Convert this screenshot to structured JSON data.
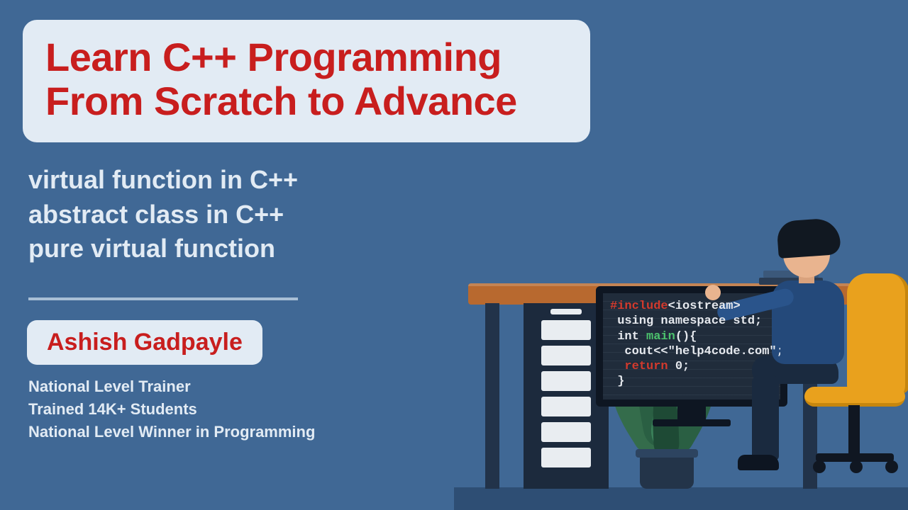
{
  "title": {
    "line1": "Learn C++ Programming",
    "line2": "From Scratch to Advance"
  },
  "topics": [
    "virtual function in C++",
    "abstract class in C++",
    "pure virtual function"
  ],
  "author": {
    "name": "Ashish Gadpayle",
    "credentials": [
      "National Level Trainer",
      "Trained 14K+ Students",
      "National Level Winner in Programming"
    ]
  },
  "code": {
    "l1a": "#include",
    "l1b": "<iostream>",
    "l2": " using namespace std;",
    "l3a": " int ",
    "l3b": "main",
    "l3c": "(){",
    "l4": "  cout<<\"help4code.com\";",
    "l5a": "  return",
    "l5b": " 0;",
    "l6": " }"
  }
}
